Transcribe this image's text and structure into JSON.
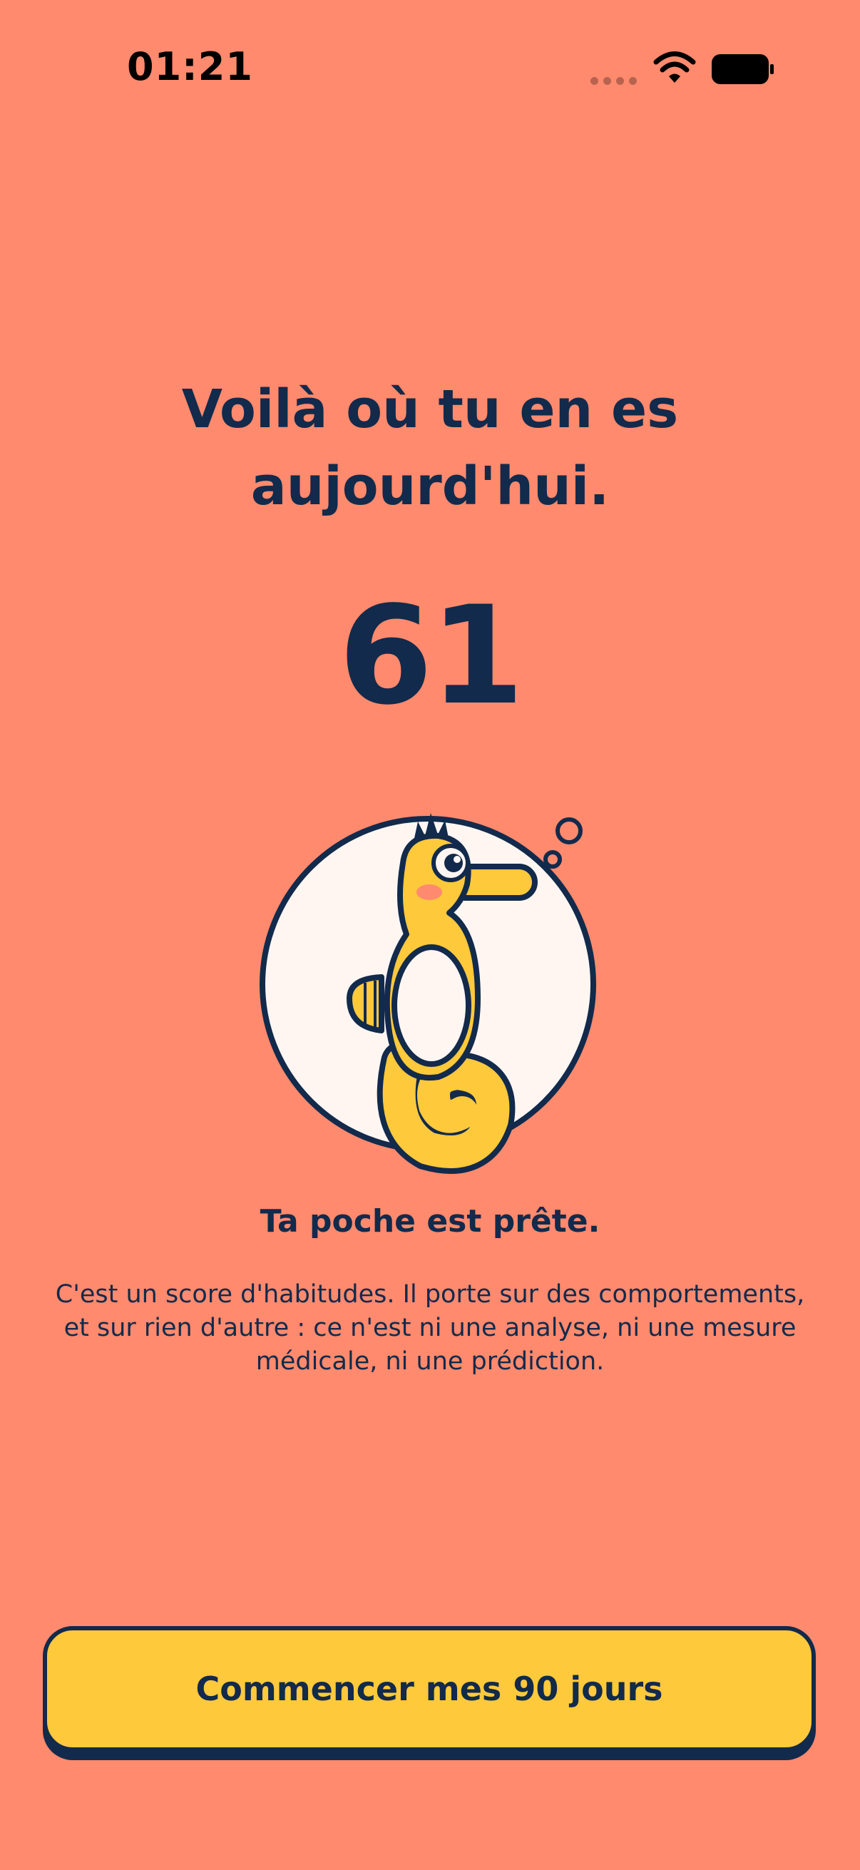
{
  "status_bar": {
    "time": "01:21"
  },
  "icons": {
    "wifi": "wifi-icon",
    "battery": "battery-icon",
    "signal": "signal-dots-icon",
    "mascot": "seahorse-mascot"
  },
  "headline": {
    "line1": "Voilà où tu en es",
    "line2": "aujourd'hui."
  },
  "score": {
    "value": "61"
  },
  "result": {
    "title": "Ta poche est prête.",
    "description_lines": [
      "C'est un score d'habitudes. Il porte sur des comportements,",
      "et sur rien d'autre : ce n'est ni une analyse, ni une mesure",
      "médicale, ni une prédiction."
    ]
  },
  "cta": {
    "label": "Commencer mes 90 jours"
  },
  "colors": {
    "background": "#FF8A6E",
    "ink": "#122A4B",
    "accent": "#FFC93C",
    "circle": "#FFF6F2"
  }
}
